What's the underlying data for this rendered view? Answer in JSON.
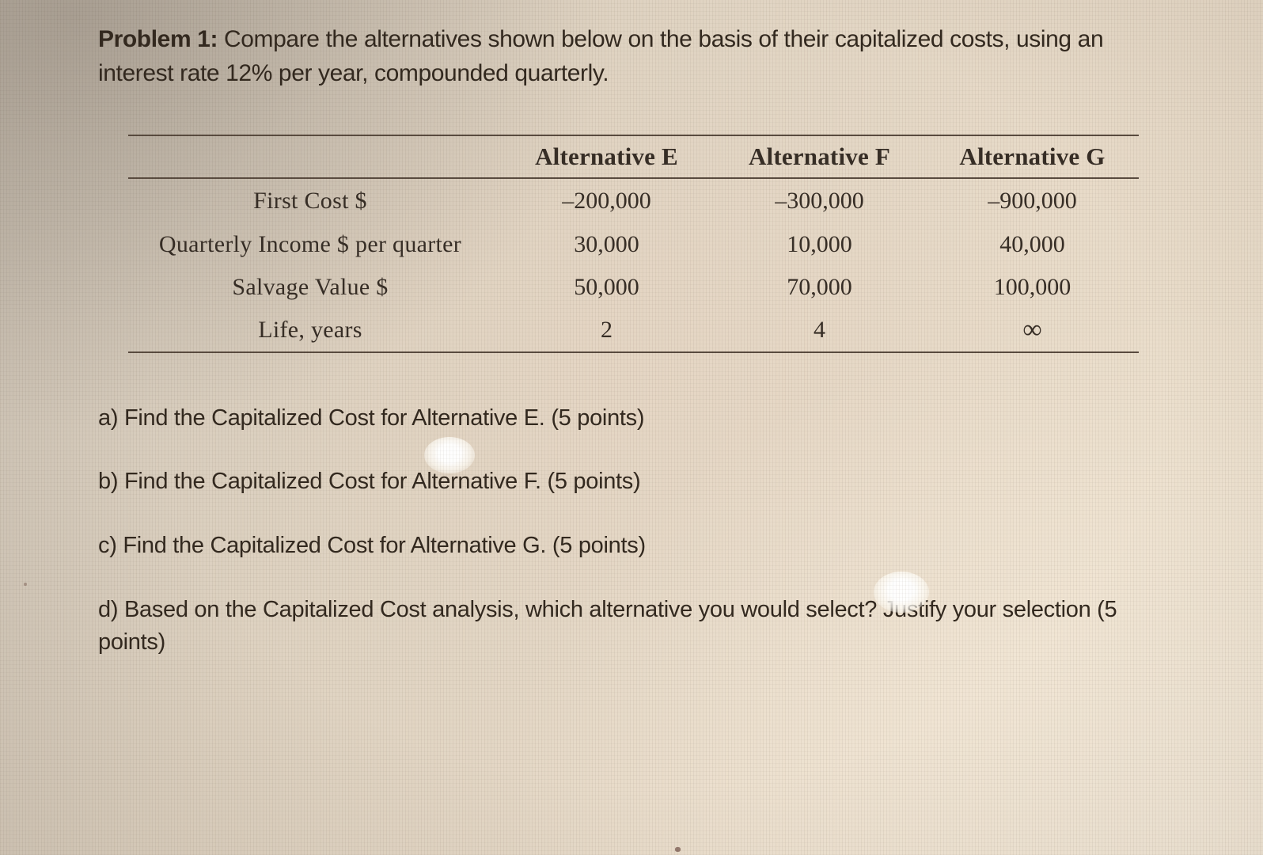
{
  "document": {
    "problem_label": "Problem 1:",
    "statement_rest": " Compare the alternatives shown below on the basis of their capitalized costs, using an interest rate 12% per year, compounded quarterly.",
    "interest_rate": "12%",
    "compounding": "quarterly"
  },
  "table": {
    "corner_header": "",
    "columns": [
      "Alternative E",
      "Alternative F",
      "Alternative G"
    ],
    "row_labels": [
      "First Cost $",
      "Quarterly Income $ per quarter",
      "Salvage Value $",
      "Life, years"
    ],
    "rows": [
      {
        "label": "First Cost $",
        "E": "–200,000",
        "F": "–300,000",
        "G": "–900,000"
      },
      {
        "label": "Quarterly Income $ per quarter",
        "E": "30,000",
        "F": "10,000",
        "G": "40,000"
      },
      {
        "label": "Salvage Value $",
        "E": "50,000",
        "F": "70,000",
        "G": "100,000"
      },
      {
        "label": "Life, years",
        "E": "2",
        "F": "4",
        "G": "∞"
      }
    ]
  },
  "questions": [
    {
      "id": "a",
      "text": "a) Find the Capitalized Cost for Alternative E. (5 points)"
    },
    {
      "id": "b",
      "text": "b) Find the Capitalized Cost for Alternative F. (5 points)"
    },
    {
      "id": "c",
      "text": "c) Find the Capitalized Cost for Alternative G. (5 points)"
    },
    {
      "id": "d",
      "text": "d) Based on the Capitalized Cost analysis, which alternative you would select? Justify your selection (5 points)"
    }
  ],
  "colors": {
    "ink": "#33291f",
    "rule": "#5a4c40",
    "paper_warm": "#e8dbc9",
    "paper_cool": "#cdc4b7"
  }
}
